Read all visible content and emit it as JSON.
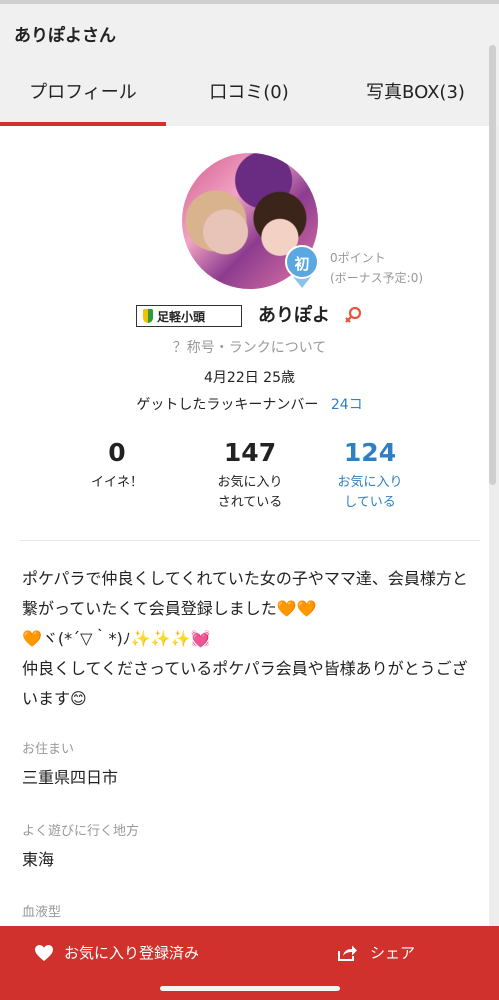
{
  "header": {
    "title": "ありぽよさん"
  },
  "tabs": [
    {
      "label": "プロフィール"
    },
    {
      "label": "口コミ(0)"
    },
    {
      "label": "写真BOX(3)"
    }
  ],
  "profile": {
    "points": "0ポイント",
    "bonus": "(ボーナス予定:0)",
    "rank_badge": "初",
    "level_badge": "足軽小頭",
    "username": "ありぽよ",
    "rank_link": "？称号・ランクについて",
    "birthday": "4月22日 25歳",
    "lucky_label": "ゲットしたラッキーナンバー",
    "lucky_count": "24コ"
  },
  "stats": [
    {
      "value": "0",
      "label": "イイネ！"
    },
    {
      "value": "147",
      "label": "お気に入り\nされている"
    },
    {
      "value": "124",
      "label": "お気に入り\nしている"
    }
  ],
  "bio": {
    "line1": "ポケパラで仲良くしてくれていた女の子やママ達、会員様方と繋がっていたくて会員登録しました🧡🧡",
    "line2": "🧡ヾ(*´▽｀*)ﾉ✨✨✨💓",
    "line3": "仲良くしてくださっているポケパラ会員や皆様ありがとうございます😊"
  },
  "fields": [
    {
      "label": "お住まい",
      "value": "三重県四日市"
    },
    {
      "label": "よく遊びに行く地方",
      "value": "東海"
    },
    {
      "label": "血液型",
      "value": ""
    }
  ],
  "bottom_bar": {
    "favorite_label": "お気に入り登録済み",
    "share_label": "シェア"
  },
  "colors": {
    "accent": "#d0312d",
    "link": "#2f7fc1",
    "badge": "#5ba7e0"
  }
}
